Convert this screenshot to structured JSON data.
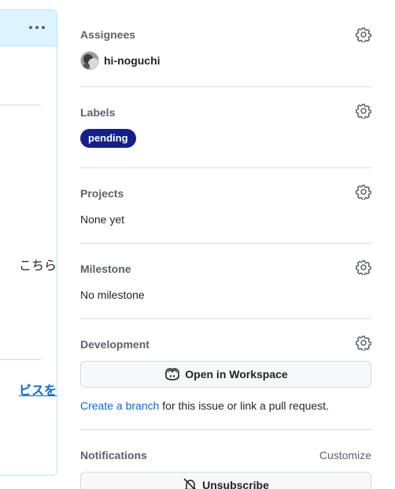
{
  "comment": {
    "text_fragment": "こちら",
    "link_fragment": "ビスを"
  },
  "sidebar": {
    "assignees": {
      "title": "Assignees",
      "user": "hi-noguchi"
    },
    "labels": {
      "title": "Labels",
      "items": [
        "pending"
      ],
      "color": "#13208b"
    },
    "projects": {
      "title": "Projects",
      "value": "None yet"
    },
    "milestone": {
      "title": "Milestone",
      "value": "No milestone"
    },
    "development": {
      "title": "Development",
      "button_label": "Open in Workspace",
      "button_icon": "copilot-icon",
      "link_text": "Create a branch",
      "rest_text": " for this issue or link a pull request."
    },
    "notifications": {
      "title": "Notifications",
      "customize_label": "Customize",
      "button_label": "Unsubscribe",
      "button_icon": "bell-slash-icon"
    }
  },
  "colors": {
    "accent_link": "#0969da",
    "header_bg": "#ddf4ff"
  }
}
